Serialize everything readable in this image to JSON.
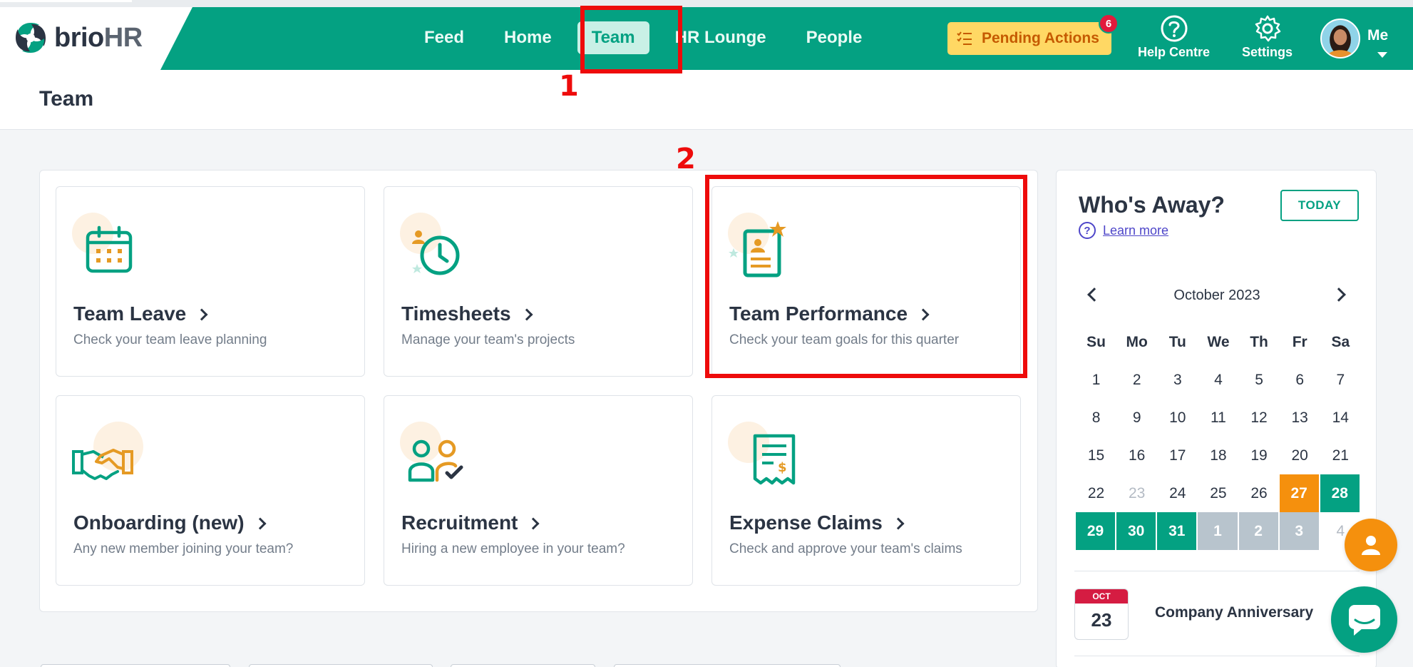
{
  "brand": {
    "name_main": "brio",
    "name_suffix": "HR",
    "accent": "#04a182",
    "highlight": "#ee0b0b"
  },
  "nav": {
    "items": [
      {
        "label": "Feed"
      },
      {
        "label": "Home"
      },
      {
        "label": "Team",
        "active": true
      },
      {
        "label": "HR Lounge"
      },
      {
        "label": "People"
      }
    ],
    "pending": {
      "label": "Pending Actions",
      "count": "6"
    },
    "help": "Help Centre",
    "settings": "Settings",
    "me": "Me"
  },
  "page": {
    "title": "Team"
  },
  "annotations": {
    "one": "1",
    "two": "2"
  },
  "cards": [
    {
      "title": "Team Leave",
      "desc": "Check your team leave planning",
      "icon": "calendar-icon"
    },
    {
      "title": "Timesheets",
      "desc": "Manage your team's projects",
      "icon": "clock-icon"
    },
    {
      "title": "Team Performance",
      "desc": "Check your team goals for this quarter",
      "icon": "performance-icon"
    },
    {
      "title": "Onboarding (new)",
      "desc": "Any new member joining your team?",
      "icon": "handshake-icon"
    },
    {
      "title": "Recruitment",
      "desc": "Hiring a new employee in your team?",
      "icon": "recruitment-icon"
    },
    {
      "title": "Expense Claims",
      "desc": "Check and approve your team's claims",
      "icon": "receipt-icon"
    }
  ],
  "away": {
    "title": "Who's Away?",
    "today": "TODAY",
    "learn_more": "Learn more",
    "month": "October 2023",
    "weekdays": [
      "Su",
      "Mo",
      "Tu",
      "We",
      "Th",
      "Fr",
      "Sa"
    ],
    "weeks": [
      [
        {
          "d": "1"
        },
        {
          "d": "2"
        },
        {
          "d": "3"
        },
        {
          "d": "4"
        },
        {
          "d": "5"
        },
        {
          "d": "6"
        },
        {
          "d": "7"
        }
      ],
      [
        {
          "d": "8"
        },
        {
          "d": "9"
        },
        {
          "d": "10"
        },
        {
          "d": "11"
        },
        {
          "d": "12"
        },
        {
          "d": "13"
        },
        {
          "d": "14"
        }
      ],
      [
        {
          "d": "15"
        },
        {
          "d": "16"
        },
        {
          "d": "17"
        },
        {
          "d": "18"
        },
        {
          "d": "19"
        },
        {
          "d": "20"
        },
        {
          "d": "21"
        }
      ],
      [
        {
          "d": "22"
        },
        {
          "d": "23",
          "s": "muted"
        },
        {
          "d": "24"
        },
        {
          "d": "25"
        },
        {
          "d": "26"
        },
        {
          "d": "27",
          "s": "orange"
        },
        {
          "d": "28",
          "s": "green"
        }
      ],
      [
        {
          "d": "29",
          "s": "green"
        },
        {
          "d": "30",
          "s": "green"
        },
        {
          "d": "31",
          "s": "green"
        },
        {
          "d": "1",
          "s": "grey"
        },
        {
          "d": "2",
          "s": "grey"
        },
        {
          "d": "3",
          "s": "grey"
        },
        {
          "d": "4",
          "s": "muted"
        }
      ]
    ],
    "event": {
      "month": "OCT",
      "day": "23",
      "name": "Company Anniversary"
    }
  }
}
